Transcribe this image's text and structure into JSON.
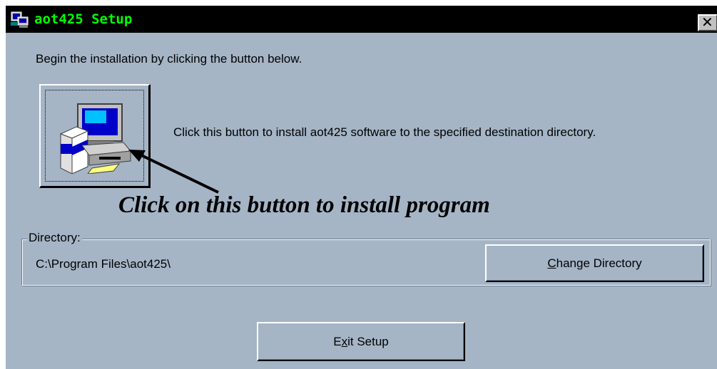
{
  "window": {
    "title": "aot425 Setup",
    "close_glyph": "✕",
    "app_icon": "computer-setup-icon"
  },
  "main": {
    "intro_text": "Begin the installation by clicking the button below.",
    "install_button_icon": "computer-install-icon",
    "install_description": "Click this button to install aot425 software to the specified destination directory.",
    "annotation": "Click on this button to install program"
  },
  "directory": {
    "legend": "Directory:",
    "path": "C:\\Program Files\\aot425\\",
    "change_button": {
      "mnemonic": "C",
      "rest": "hange Directory"
    }
  },
  "footer": {
    "exit_button": {
      "before": "E",
      "mnemonic": "x",
      "after": "it Setup"
    }
  },
  "colors": {
    "window_bg": "#a5b5c6",
    "titlebar_bg": "#000000",
    "title_text": "#00ff00"
  }
}
